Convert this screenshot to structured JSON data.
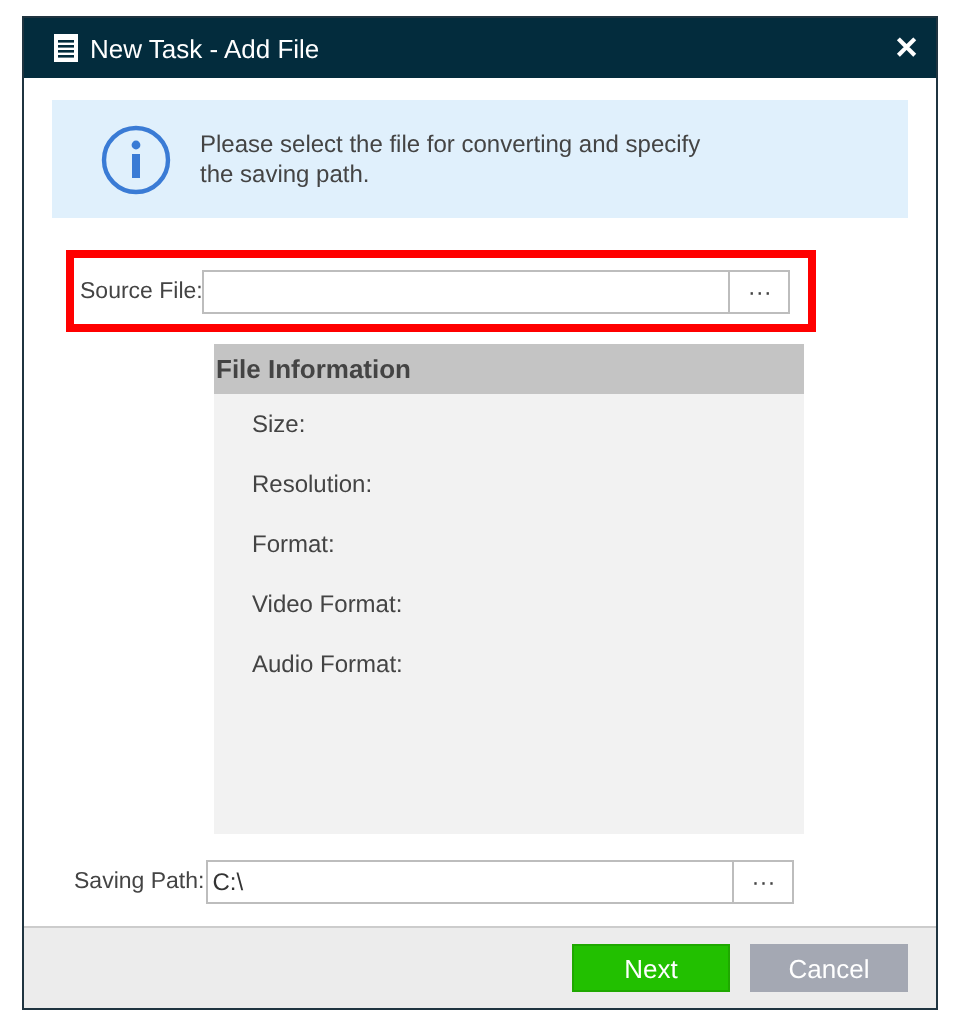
{
  "window": {
    "title": "New Task - Add File",
    "close": "✕"
  },
  "info": {
    "message": "Please select the file for converting and specify the saving path."
  },
  "source_file": {
    "label": "Source File:",
    "browse": "···",
    "highlighted": true
  },
  "file_information": {
    "title": "File Information",
    "fields": [
      "Size:",
      "Resolution:",
      "Format:",
      "Video Format:",
      "Audio Format:"
    ]
  },
  "saving_path": {
    "label": "Saving Path:",
    "value": "C:\\",
    "browse": "···",
    "highlighted": false
  },
  "buttons": [
    {
      "label": "Next",
      "kind": "primary"
    },
    {
      "label": "Cancel",
      "kind": "secondary"
    }
  ]
}
